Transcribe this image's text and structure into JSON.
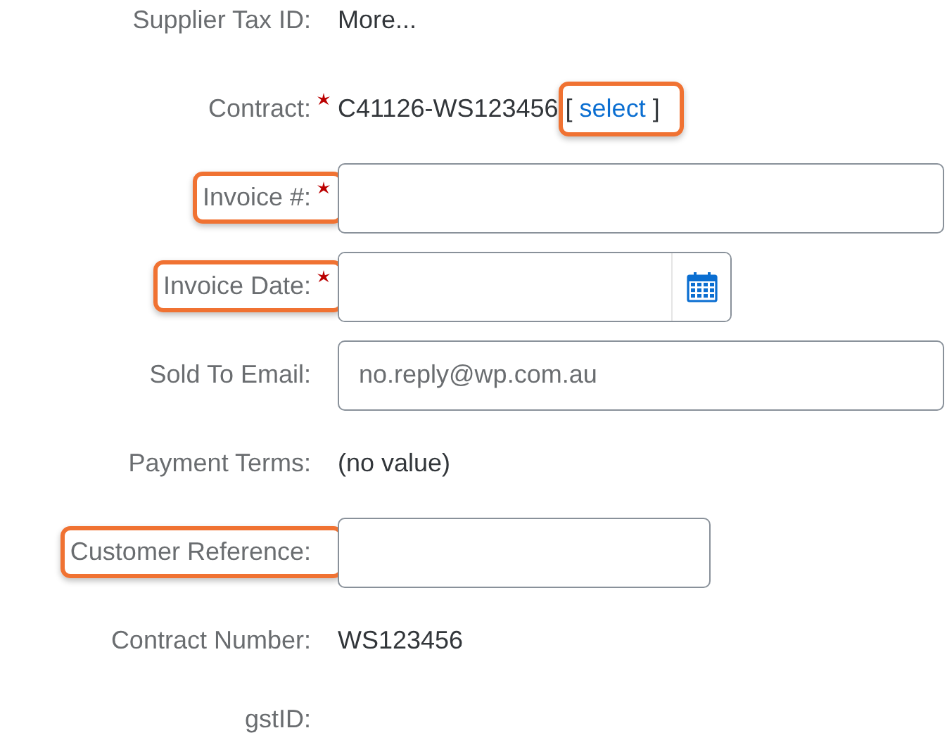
{
  "fields": [
    {
      "label": "Supplier Tax ID:",
      "required": false,
      "highlighted": false,
      "kind": "text",
      "value": "More..."
    },
    {
      "label": "Contract:",
      "required": true,
      "highlighted": false,
      "kind": "text",
      "value": "C41126-WS123456",
      "link": {
        "open": "[",
        "text": "select",
        "close": "]",
        "highlighted": true
      }
    },
    {
      "label": "Invoice #:",
      "required": true,
      "highlighted": true,
      "kind": "input"
    },
    {
      "label": "Invoice Date:",
      "required": true,
      "highlighted": true,
      "kind": "date"
    },
    {
      "label": "Sold To Email:",
      "required": false,
      "highlighted": false,
      "kind": "input",
      "value": "no.reply@wp.com.au"
    },
    {
      "label": "Payment Terms:",
      "required": false,
      "highlighted": false,
      "kind": "text",
      "value": "(no value)"
    },
    {
      "label": "Customer Reference:",
      "required": false,
      "highlighted": true,
      "kind": "short-input"
    },
    {
      "label": "Contract Number:",
      "required": false,
      "highlighted": false,
      "kind": "text",
      "value": "WS123456"
    },
    {
      "label": "gstID:",
      "required": false,
      "highlighted": false,
      "kind": "text"
    }
  ]
}
